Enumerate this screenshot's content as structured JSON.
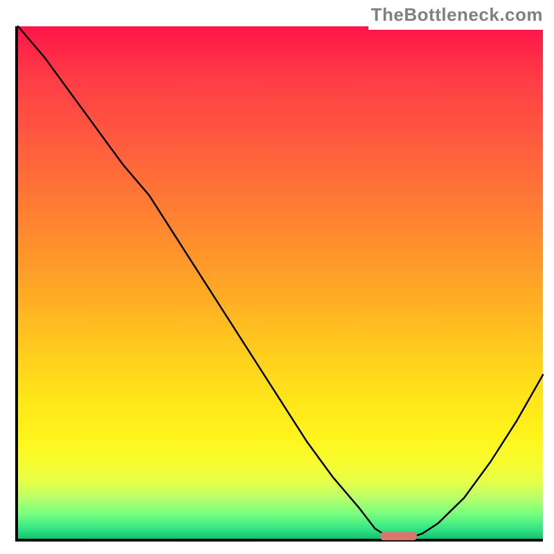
{
  "watermark": "TheBottleneck.com",
  "colors": {
    "gradient_top": "#ff144a",
    "gradient_mid": "#ffc81e",
    "gradient_bottom": "#14c270",
    "axis": "#000000",
    "curve": "#000000",
    "marker": "#d9766e"
  },
  "chart_data": {
    "type": "line",
    "title": "",
    "xlabel": "",
    "ylabel": "",
    "xlim": [
      0,
      100
    ],
    "ylim": [
      0,
      100
    ],
    "x": [
      0,
      5,
      10,
      15,
      20,
      25,
      30,
      35,
      40,
      45,
      50,
      55,
      60,
      65,
      68,
      71,
      74,
      77,
      80,
      85,
      90,
      95,
      100
    ],
    "values": [
      100,
      94,
      87,
      80,
      73,
      67,
      59,
      51,
      43,
      35,
      27,
      19,
      12,
      6,
      2,
      0,
      0,
      1,
      3,
      8,
      15,
      23,
      32
    ],
    "marker": {
      "x_start": 69,
      "x_end": 76,
      "y": 0.5
    }
  }
}
